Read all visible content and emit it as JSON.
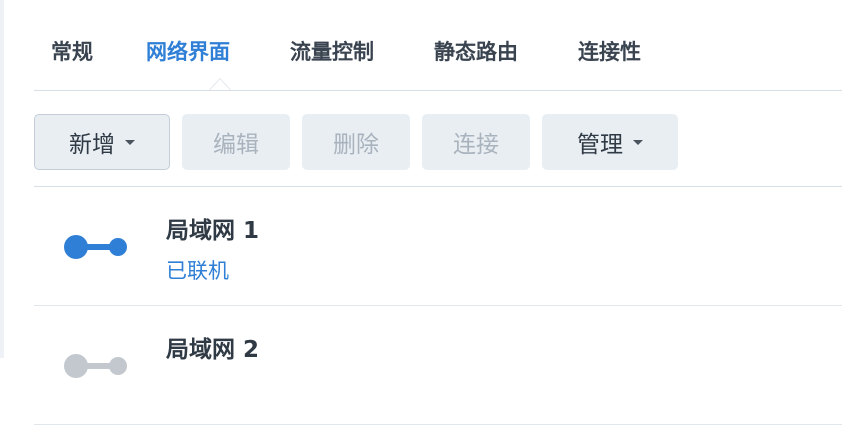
{
  "tabs": [
    {
      "label": "常规",
      "active": false
    },
    {
      "label": "网络界面",
      "active": true
    },
    {
      "label": "流量控制",
      "active": false
    },
    {
      "label": "静态路由",
      "active": false
    },
    {
      "label": "连接性",
      "active": false
    }
  ],
  "toolbar": {
    "create_label": "新增",
    "edit_label": "编辑",
    "delete_label": "删除",
    "connect_label": "连接",
    "manage_label": "管理"
  },
  "interfaces": [
    {
      "name": "局域网 1",
      "status": "已联机",
      "connected": true,
      "icon": "network-connected-icon"
    },
    {
      "name": "局域网 2",
      "status": "",
      "connected": false,
      "icon": "network-disconnected-icon"
    }
  ],
  "colors": {
    "accent": "#2f7fd6",
    "connected_icon": "#2f7fd6",
    "disconnected_icon": "#c2c8ce",
    "button_bg": "#e9eef3",
    "disabled_text": "#a9b3bd"
  }
}
